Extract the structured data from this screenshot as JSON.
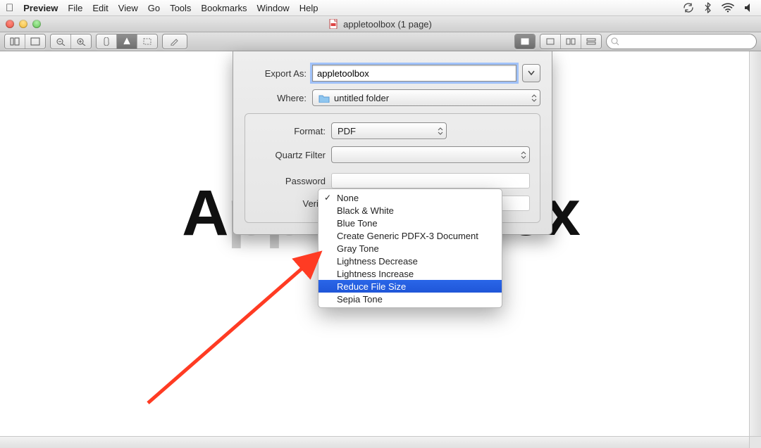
{
  "menubar": {
    "app": "Preview",
    "items": [
      "File",
      "Edit",
      "View",
      "Go",
      "Tools",
      "Bookmarks",
      "Window",
      "Help"
    ]
  },
  "window": {
    "title": "appletoolbox (1 page)"
  },
  "sheet": {
    "export_as_label": "Export As:",
    "export_as_value": "appletoolbox",
    "where_label": "Where:",
    "where_value": "untitled folder",
    "format_label": "Format:",
    "format_value": "PDF",
    "quartz_label": "Quartz Filter",
    "password_label": "Password",
    "verify_label": "Verify"
  },
  "quartz_menu": {
    "items": [
      "None",
      "Black & White",
      "Blue Tone",
      "Create Generic PDFX-3 Document",
      "Gray Tone",
      "Lightness Decrease",
      "Lightness Increase",
      "Reduce File Size",
      "Sepia Tone"
    ],
    "checked_index": 0,
    "highlighted_index": 7
  },
  "watermark": {
    "text_left": "A",
    "text_mid1": "pple",
    "text_mid2": "toolb",
    "text_right": "ox"
  }
}
